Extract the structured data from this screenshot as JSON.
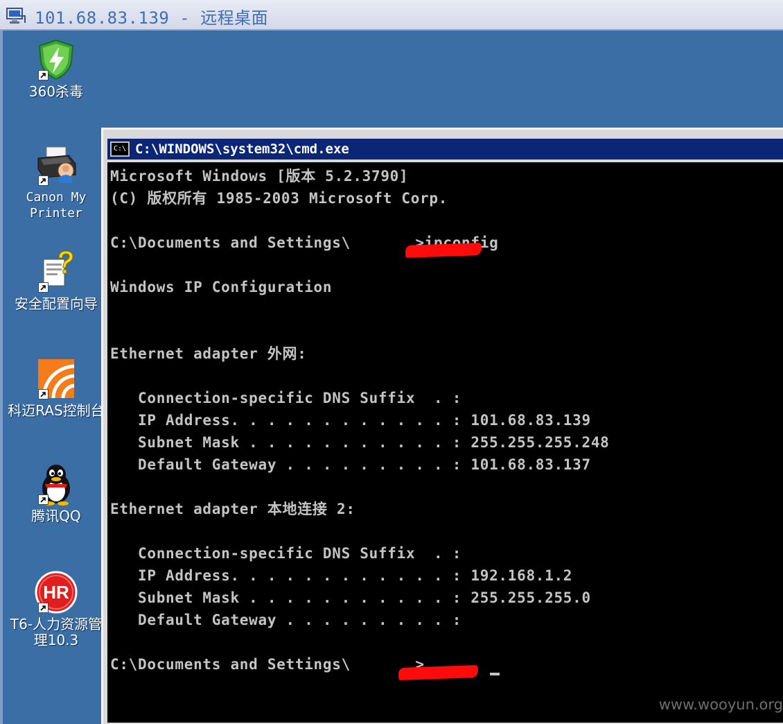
{
  "remote_desktop": {
    "title": "101.68.83.139 - 远程桌面"
  },
  "desktop_icons": [
    {
      "label": "360杀毒",
      "icon": "antivirus-shield-icon"
    },
    {
      "label": "Canon My Printer",
      "icon": "printer-icon"
    },
    {
      "label": "安全配置向导",
      "icon": "help-wizard-icon"
    },
    {
      "label": "科迈RAS控制台",
      "icon": "ras-console-icon"
    },
    {
      "label": "腾讯QQ",
      "icon": "qq-penguin-icon"
    },
    {
      "label": "T6-人力资源管理10.3",
      "icon": "hr-logo-icon"
    }
  ],
  "cmd_window": {
    "icon_text": "C:\\",
    "title": "C:\\WINDOWS\\system32\\cmd.exe",
    "console_text": "Microsoft Windows [版本 5.2.3790]\n(C) 版权所有 1985-2003 Microsoft Corp.\n\nC:\\Documents and Settings\\       >ipconfig\n\nWindows IP Configuration\n\n\nEthernet adapter 外网:\n\n   Connection-specific DNS Suffix  . :\n   IP Address. . . . . . . . . . . . : 101.68.83.139\n   Subnet Mask . . . . . . . . . . . : 255.255.255.248\n   Default Gateway . . . . . . . . . : 101.68.83.137\n\nEthernet adapter 本地连接 2:\n\n   Connection-specific DNS Suffix  . :\n   IP Address. . . . . . . . . . . . : 192.168.1.2\n   Subnet Mask . . . . . . . . . . . : 255.255.255.0\n   Default Gateway . . . . . . . . . :\n\nC:\\Documents and Settings\\       >"
  },
  "watermark": "www.wooyun.org"
}
